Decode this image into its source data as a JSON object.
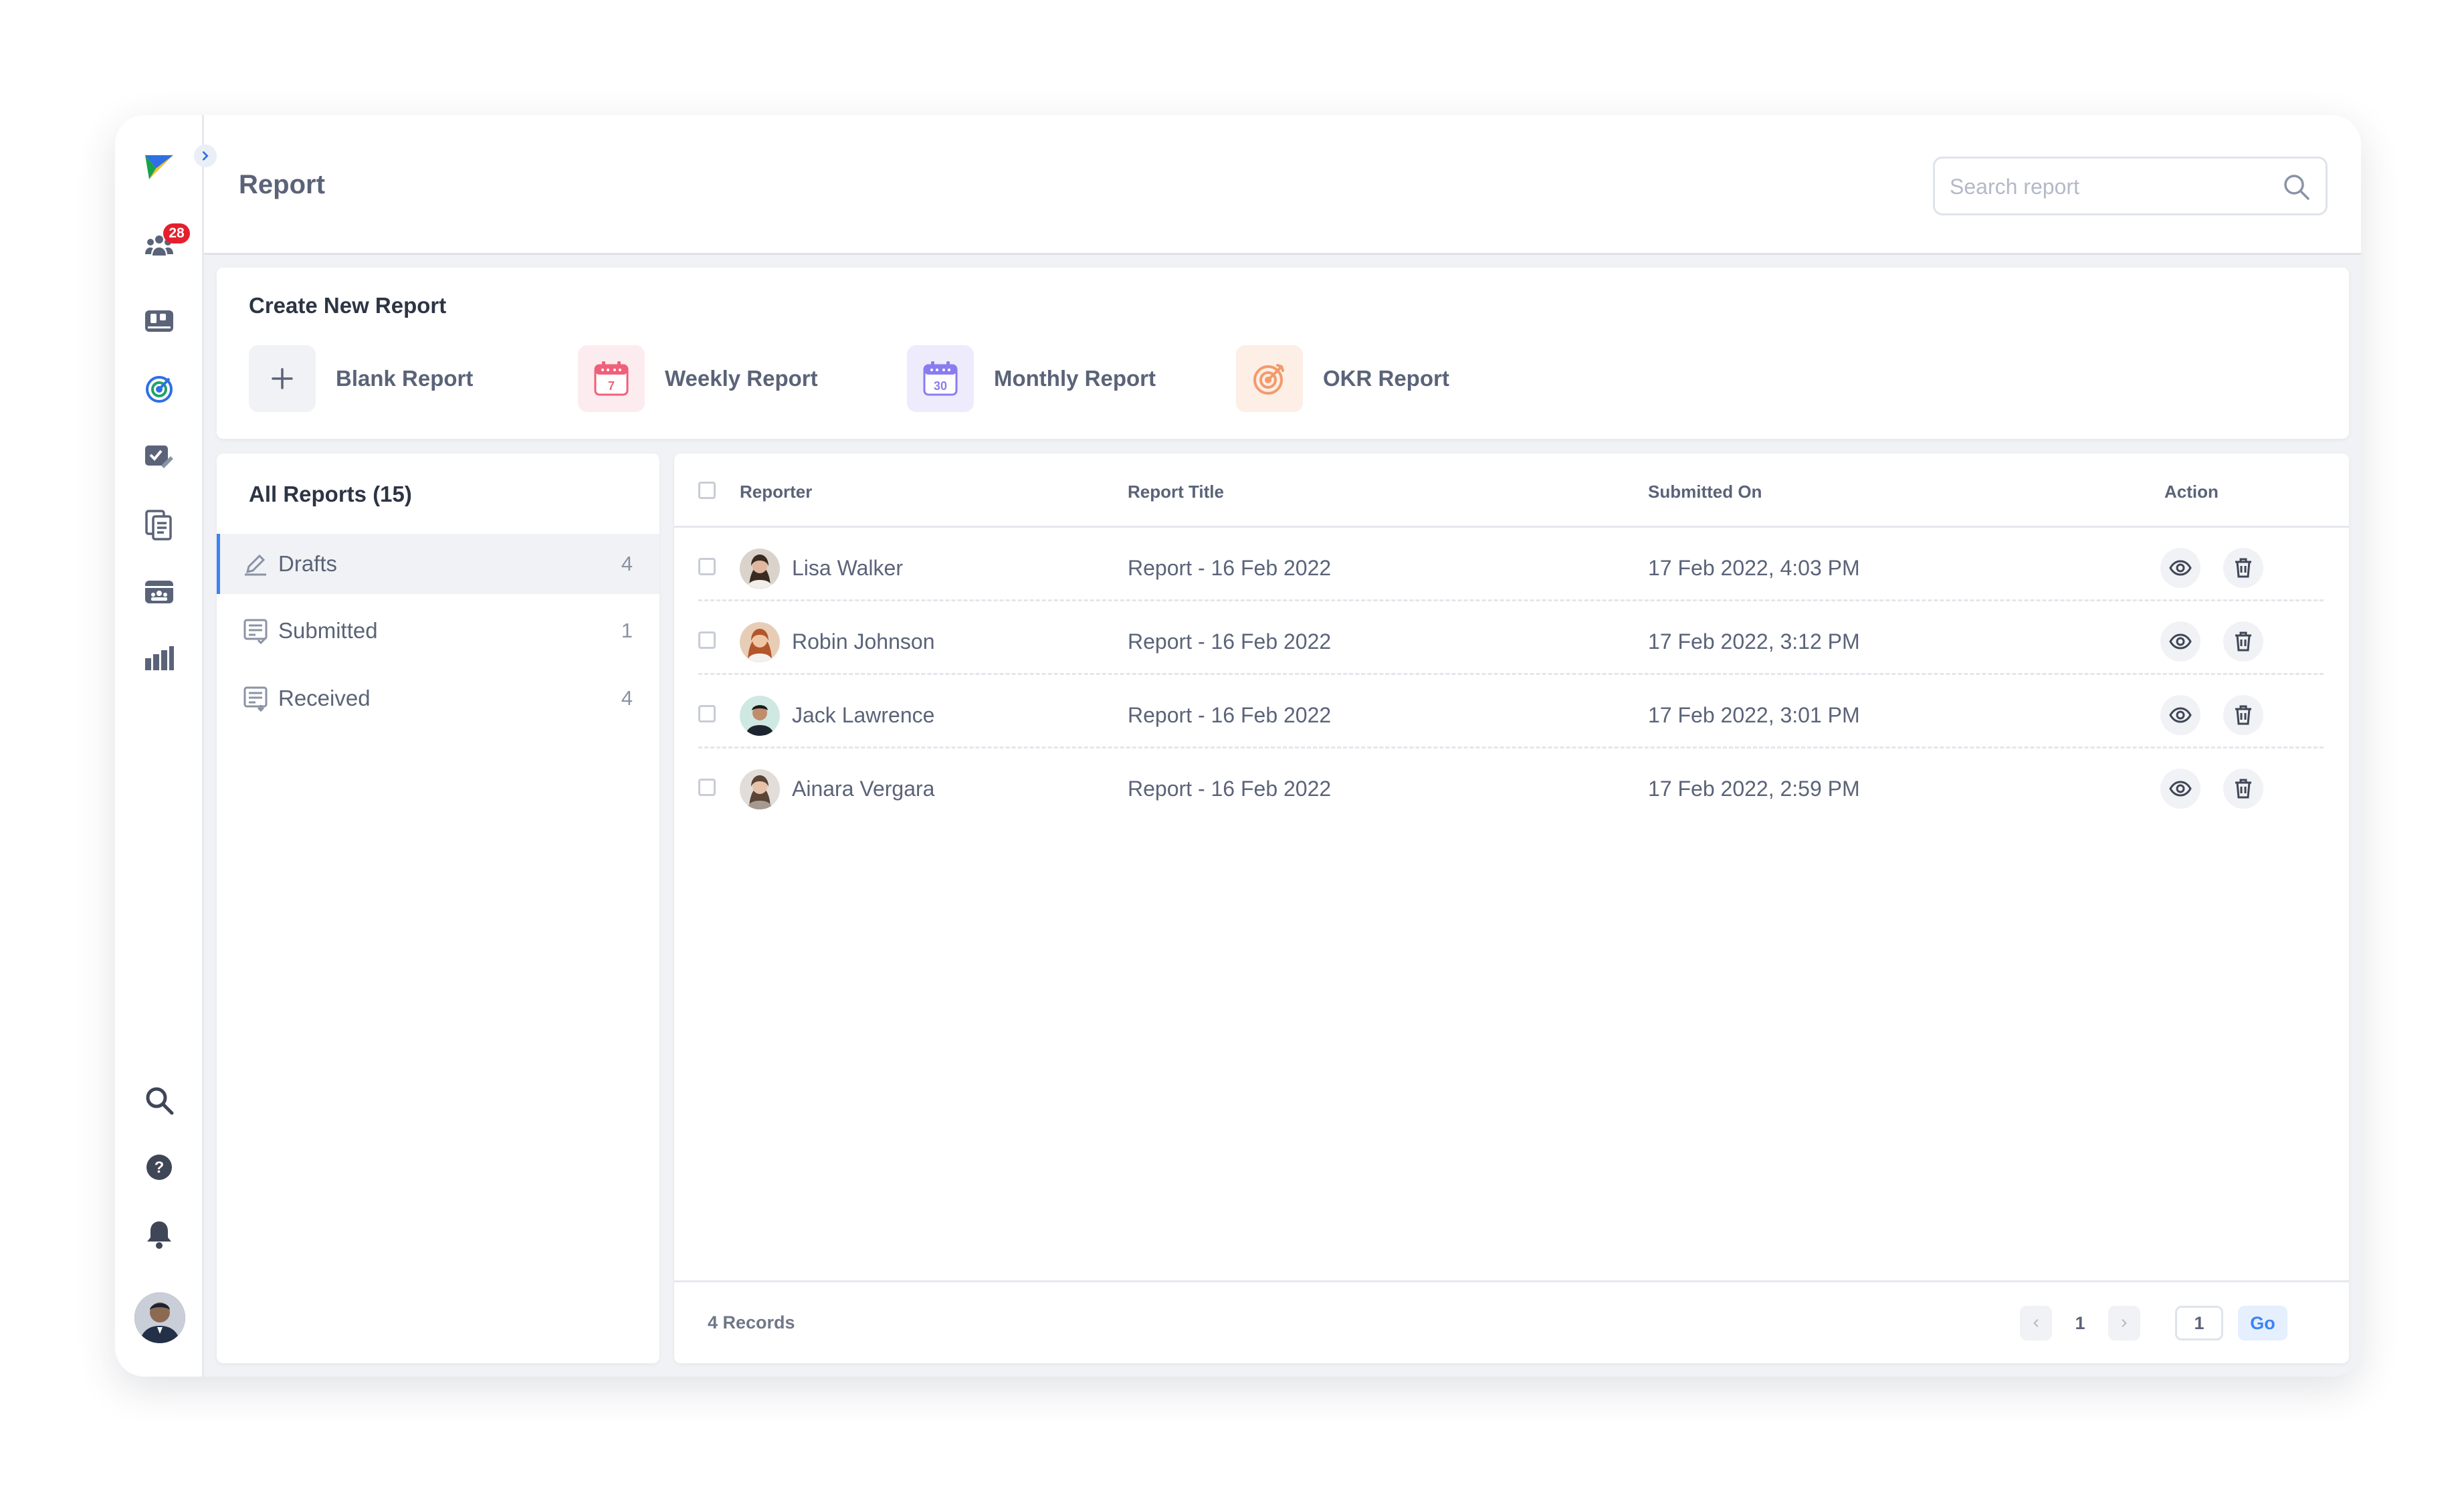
{
  "header": {
    "title": "Report",
    "search_placeholder": "Search report"
  },
  "rail": {
    "notification_badge": "28",
    "icons": [
      "brand-logo-icon",
      "people-icon",
      "board-icon",
      "target-icon",
      "task-edit-icon",
      "documents-icon",
      "team-card-icon",
      "bar-chart-icon",
      "search-icon",
      "help-icon",
      "bell-icon"
    ]
  },
  "create": {
    "title": "Create New Report",
    "options": [
      {
        "label": "Blank Report"
      },
      {
        "label": "Weekly Report",
        "calendar_day": "7"
      },
      {
        "label": "Monthly Report",
        "calendar_day": "30"
      },
      {
        "label": "OKR Report"
      }
    ]
  },
  "sidebar": {
    "title": "All Reports (15)",
    "items": [
      {
        "label": "Drafts",
        "count": "4"
      },
      {
        "label": "Submitted",
        "count": "1"
      },
      {
        "label": "Received",
        "count": "4"
      }
    ]
  },
  "table": {
    "columns": [
      "Reporter",
      "Report Title",
      "Submitted On",
      "Action"
    ],
    "rows": [
      {
        "reporter": "Lisa Walker",
        "title": "Report - 16 Feb 2022",
        "submitted": "17 Feb 2022, 4:03 PM"
      },
      {
        "reporter": "Robin Johnson",
        "title": "Report - 16 Feb 2022",
        "submitted": "17 Feb 2022, 3:12 PM"
      },
      {
        "reporter": "Jack Lawrence",
        "title": "Report - 16 Feb 2022",
        "submitted": "17 Feb 2022, 3:01 PM"
      },
      {
        "reporter": "Ainara Vergara",
        "title": "Report - 16 Feb 2022",
        "submitted": "17 Feb 2022, 2:59 PM"
      }
    ],
    "footer": {
      "records": "4 Records",
      "current_page": "1",
      "goto_value": "1",
      "go_label": "Go"
    }
  },
  "colors": {
    "accent": "#3b82f6",
    "badge": "#e5202e",
    "weekly": "#f0607a",
    "monthly": "#8a7cf0",
    "okr": "#f39a6a"
  }
}
